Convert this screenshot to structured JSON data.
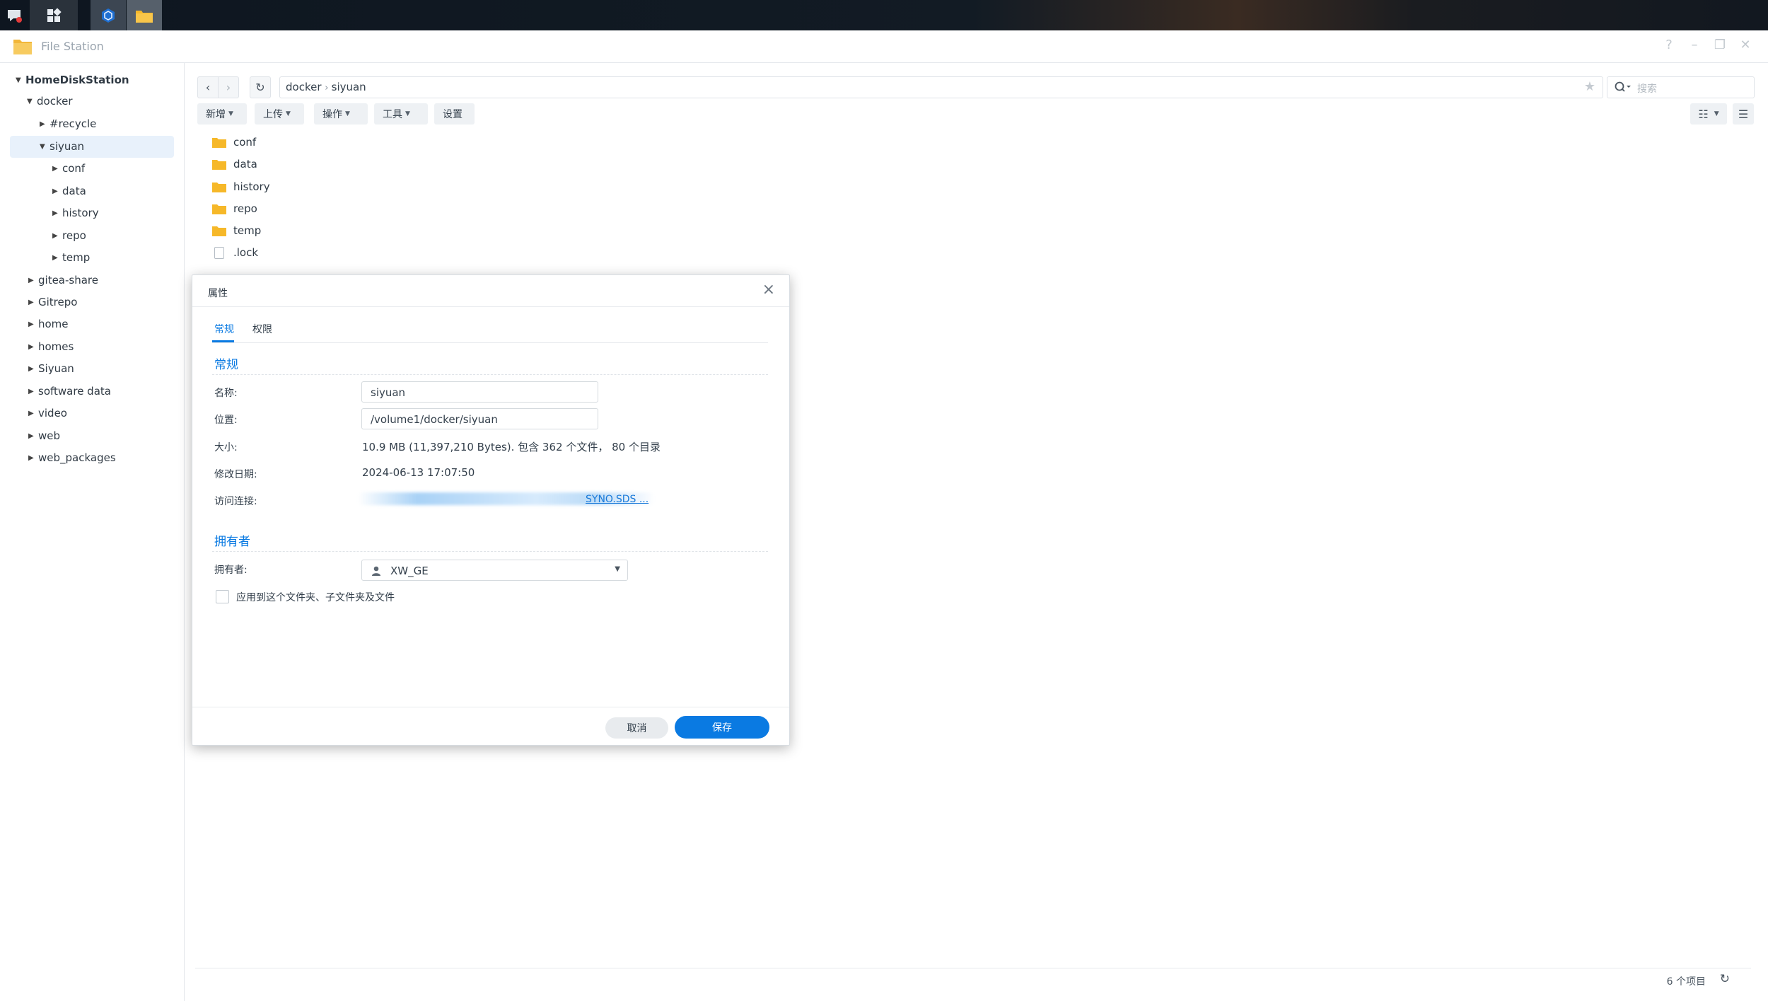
{
  "app": {
    "title": "File Station"
  },
  "sidebar": {
    "root": "HomeDiskStation",
    "items": [
      {
        "label": "docker"
      },
      {
        "label": "#recycle"
      },
      {
        "label": "siyuan"
      },
      {
        "label": "conf"
      },
      {
        "label": "data"
      },
      {
        "label": "history"
      },
      {
        "label": "repo"
      },
      {
        "label": "temp"
      },
      {
        "label": "gitea-share"
      },
      {
        "label": "Gitrepo"
      },
      {
        "label": "home"
      },
      {
        "label": "homes"
      },
      {
        "label": "Siyuan"
      },
      {
        "label": "software data"
      },
      {
        "label": "video"
      },
      {
        "label": "web"
      },
      {
        "label": "web_packages"
      }
    ]
  },
  "path": {
    "segments": [
      "docker",
      "siyuan"
    ]
  },
  "search": {
    "placeholder": "搜索"
  },
  "actions": {
    "create": "新增",
    "upload": "上传",
    "operate": "操作",
    "tools": "工具",
    "settings": "设置"
  },
  "files": [
    {
      "name": "conf",
      "type": "folder"
    },
    {
      "name": "data",
      "type": "folder"
    },
    {
      "name": "history",
      "type": "folder"
    },
    {
      "name": "repo",
      "type": "folder"
    },
    {
      "name": "temp",
      "type": "folder"
    },
    {
      "name": ".lock",
      "type": "file"
    }
  ],
  "status": {
    "count": "6 个项目"
  },
  "dialog": {
    "title": "属性",
    "tabs": [
      "常规",
      "权限"
    ],
    "section_general": "常规",
    "name_label": "名称:",
    "name_value": "siyuan",
    "location_label": "位置:",
    "location_value": "/volume1/docker/siyuan",
    "size_label": "大小:",
    "size_value": "10.9 MB (11,397,210 Bytes). 包含 362 个文件， 80 个目录",
    "modified_label": "修改日期:",
    "modified_value": "2024-06-13 17:07:50",
    "link_label": "访问连接:",
    "link_value": "SYNO.SDS ...",
    "section_owner": "拥有者",
    "owner_label": "拥有者:",
    "owner_value": "XW_GE",
    "apply_label": "应用到这个文件夹、子文件夹及文件",
    "cancel": "取消",
    "save": "保存"
  },
  "colors": {
    "accent": "#0a7ae2",
    "folder": "#f6b829"
  }
}
